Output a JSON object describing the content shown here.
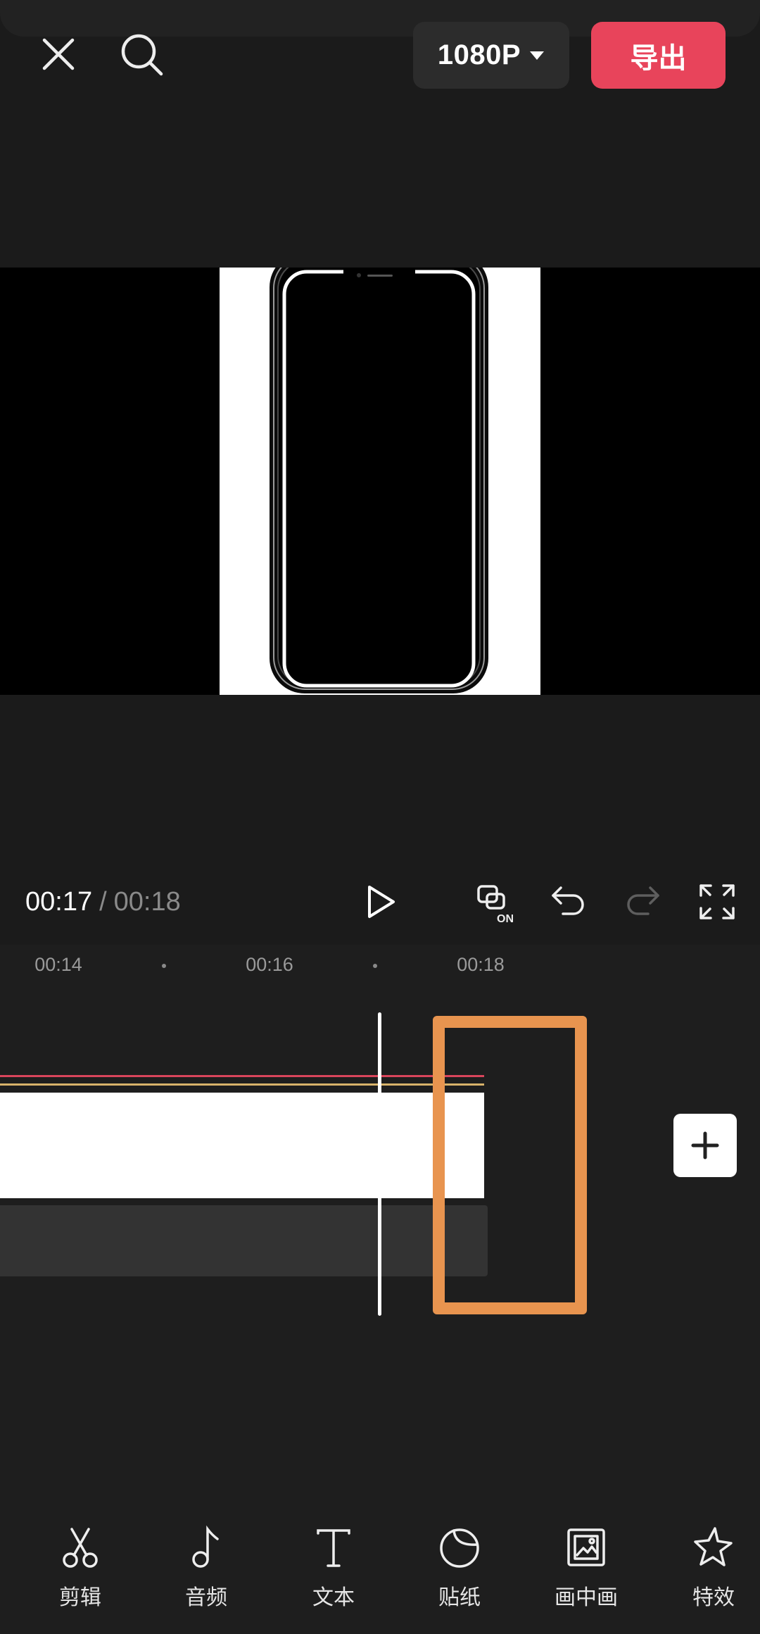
{
  "header": {
    "quality_label": "1080P",
    "export_label": "导出",
    "icons": {
      "close": "close-icon",
      "search": "search-icon",
      "dropdown": "caret-down-icon"
    }
  },
  "player": {
    "current_time": "00:17",
    "separator": "/",
    "total_time": "00:18",
    "keyframe_badge": "ON",
    "icons": [
      "play-icon",
      "keyframe-on-icon",
      "undo-icon",
      "redo-icon",
      "fullscreen-icon"
    ]
  },
  "timeline": {
    "ruler": [
      {
        "label": "00:14"
      },
      {
        "label": "00:16"
      },
      {
        "label": "00:18"
      }
    ],
    "add_clip_icon": "plus-icon"
  },
  "toolbar": {
    "items": [
      {
        "label": "剪辑",
        "icon": "scissors-icon"
      },
      {
        "label": "音频",
        "icon": "music-note-icon"
      },
      {
        "label": "文本",
        "icon": "text-icon"
      },
      {
        "label": "贴纸",
        "icon": "sticker-icon"
      },
      {
        "label": "画中画",
        "icon": "picture-in-picture-icon"
      },
      {
        "label": "特效",
        "icon": "effects-star-icon"
      }
    ]
  },
  "colors": {
    "background": "#1b1b1b",
    "export_button": "#e8445b",
    "selection_outline": "#e8944f",
    "track_red_line": "#d9455b",
    "track_yellow_line": "#d8b36a"
  }
}
